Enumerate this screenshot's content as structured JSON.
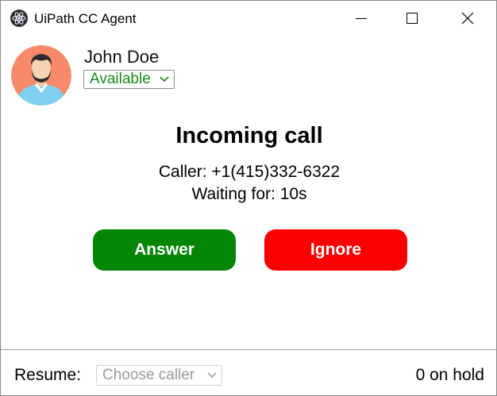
{
  "window": {
    "title": "UiPath CC Agent",
    "controls": [
      "minimize",
      "maximize",
      "close"
    ]
  },
  "agent": {
    "name": "John Doe",
    "status": "Available",
    "status_color": "#1a8a1a",
    "avatar_icon": "agent-avatar-icon"
  },
  "call": {
    "heading": "Incoming call",
    "caller_text": "Caller: +1(415)332-6322",
    "waiting_text": "Waiting for: 10s",
    "answer_label": "Answer",
    "answer_color": "#048504",
    "ignore_label": "Ignore",
    "ignore_color": "#fb0000"
  },
  "footer": {
    "resume_label": "Resume:",
    "caller_select_placeholder": "Choose caller",
    "hold_text": "0 on hold"
  }
}
